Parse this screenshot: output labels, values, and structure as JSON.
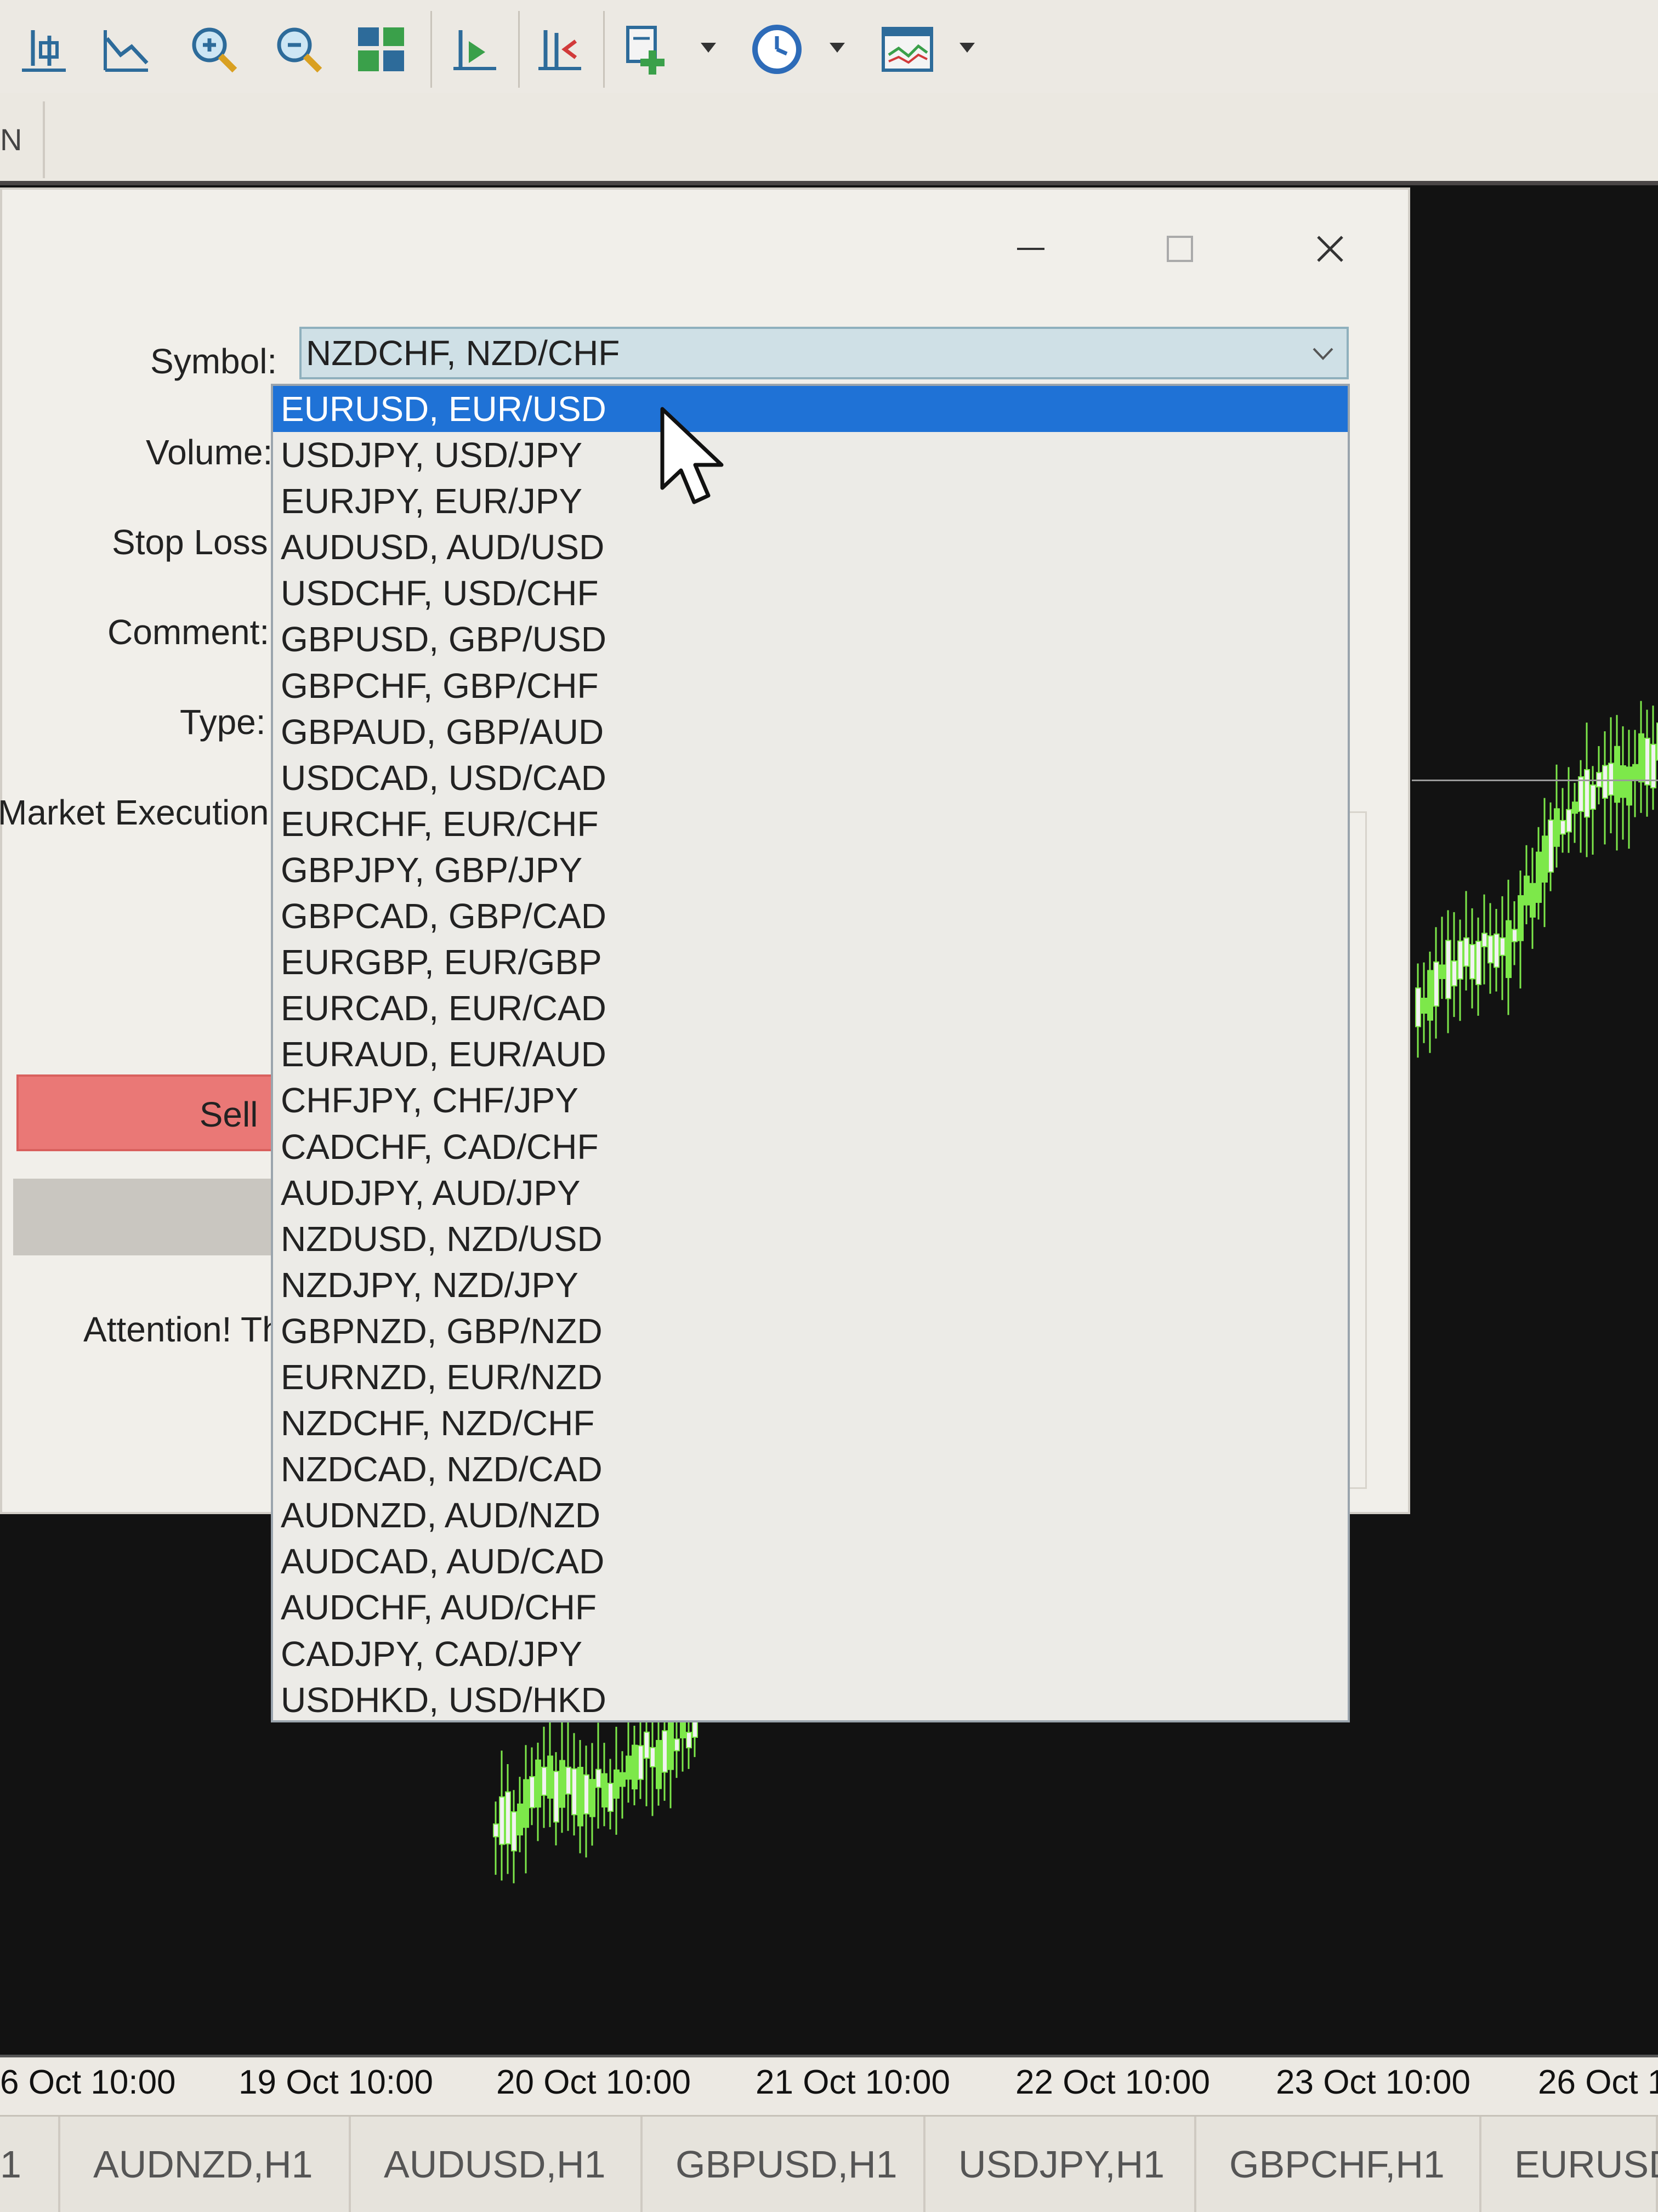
{
  "toolbar": {
    "buttons": [
      {
        "name": "bar-chart-icon"
      },
      {
        "name": "line-chart-icon"
      },
      {
        "name": "zoom-in-icon"
      },
      {
        "name": "zoom-out-icon"
      },
      {
        "name": "tile-windows-icon"
      },
      {
        "name": "chart-shift-icon"
      },
      {
        "name": "autoscroll-icon"
      },
      {
        "name": "indicators-icon"
      },
      {
        "name": "periods-clock-icon"
      },
      {
        "name": "templates-icon"
      }
    ]
  },
  "secondary_toolbar": {
    "label": "N"
  },
  "dialog": {
    "fields": {
      "symbol": "Symbol:",
      "volume": "Volume:",
      "stop_loss": "Stop Loss:",
      "comment": "Comment:",
      "type": "Type:",
      "execution": "Market Execution",
      "attention": "Attention! Th"
    },
    "symbol_value": "NZDCHF, NZD/CHF",
    "sell_label": "Sell I"
  },
  "symbol_dropdown": {
    "selected_index": 0,
    "options": [
      "EURUSD, EUR/USD",
      "USDJPY, USD/JPY",
      "EURJPY, EUR/JPY",
      "AUDUSD, AUD/USD",
      "USDCHF, USD/CHF",
      "GBPUSD, GBP/USD",
      "GBPCHF, GBP/CHF",
      "GBPAUD, GBP/AUD",
      "USDCAD, USD/CAD",
      "EURCHF, EUR/CHF",
      "GBPJPY, GBP/JPY",
      "GBPCAD, GBP/CAD",
      "EURGBP, EUR/GBP",
      "EURCAD, EUR/CAD",
      "EURAUD, EUR/AUD",
      "CHFJPY, CHF/JPY",
      "CADCHF, CAD/CHF",
      "AUDJPY, AUD/JPY",
      "NZDUSD, NZD/USD",
      "NZDJPY, NZD/JPY",
      "GBPNZD, GBP/NZD",
      "EURNZD, EUR/NZD",
      "NZDCHF, NZD/CHF",
      "NZDCAD, NZD/CAD",
      "AUDNZD, AUD/NZD",
      "AUDCAD, AUD/CAD",
      "AUDCHF, AUD/CHF",
      "CADJPY, CAD/JPY",
      "USDHKD, USD/HKD"
    ]
  },
  "chart": {
    "date_labels": [
      "6 Oct 10:00",
      "19 Oct 10:00",
      "20 Oct 10:00",
      "21 Oct 10:00",
      "22 Oct 10:00",
      "23 Oct 10:00",
      "26 Oct 1"
    ],
    "candle_up_color": "#7de84a",
    "candle_down_color": "#f2f2f2"
  },
  "tabs": [
    "1",
    "AUDNZD,H1",
    "AUDUSD,H1",
    "GBPUSD,H1",
    "USDJPY,H1",
    "GBPCHF,H1",
    "EURUSD"
  ]
}
